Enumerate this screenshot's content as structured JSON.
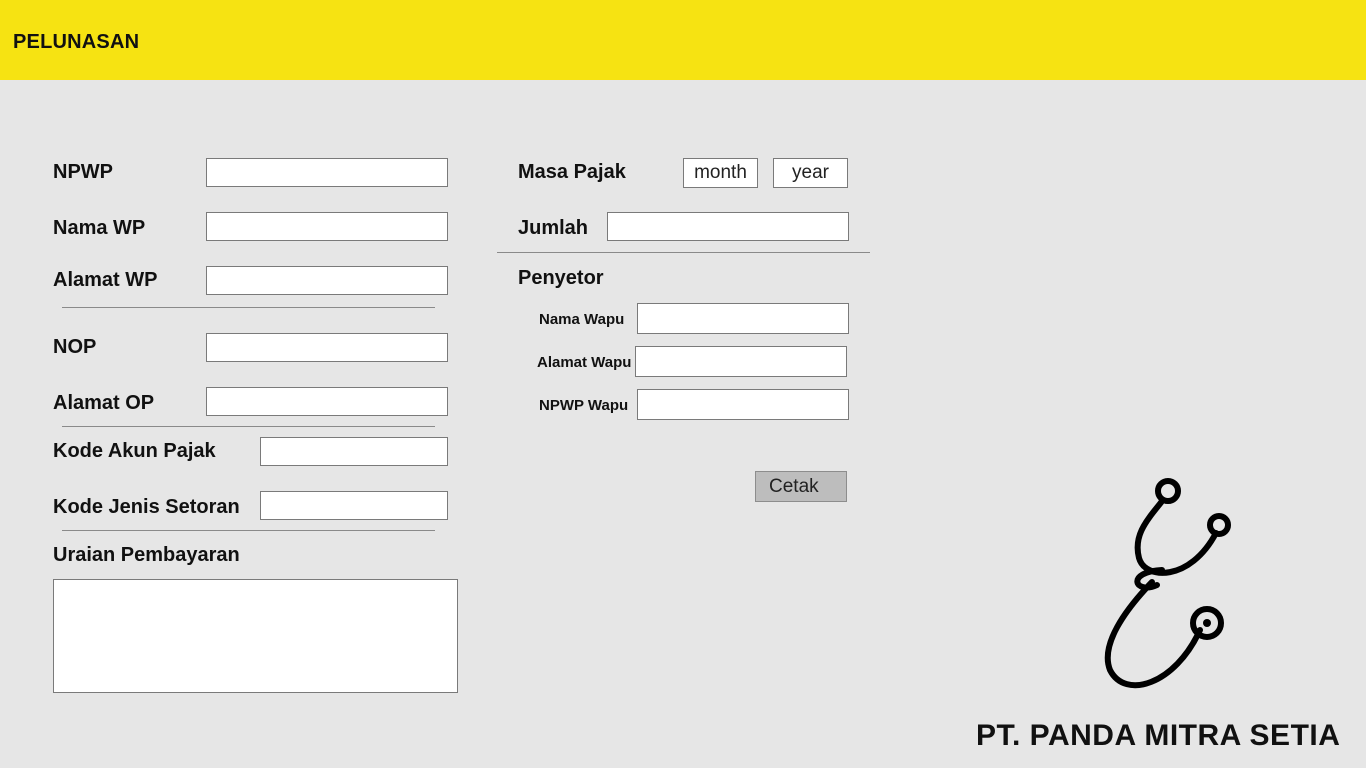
{
  "header": {
    "title": "PELUNASAN",
    "color": "#f6e312"
  },
  "form": {
    "npwp": {
      "label": "NPWP",
      "value": ""
    },
    "nama_wp": {
      "label": "Nama WP",
      "value": ""
    },
    "alamat_wp": {
      "label": "Alamat WP",
      "value": ""
    },
    "nop": {
      "label": "NOP",
      "value": ""
    },
    "alamat_op": {
      "label": "Alamat OP",
      "value": ""
    },
    "kode_akun_pajak": {
      "label": "Kode Akun Pajak",
      "value": ""
    },
    "kode_jenis_setoran": {
      "label": "Kode Jenis Setoran",
      "value": ""
    },
    "uraian_pembayaran": {
      "label": "Uraian Pembayaran",
      "value": ""
    },
    "masa_pajak": {
      "label": "Masa Pajak",
      "month": "month",
      "year": "year"
    },
    "jumlah": {
      "label": "Jumlah",
      "value": ""
    },
    "penyetor": {
      "heading": "Penyetor",
      "nama_wapu": {
        "label": "Nama Wapu",
        "value": ""
      },
      "alamat_wapu": {
        "label": "Alamat Wapu",
        "value": ""
      },
      "npwp_wapu": {
        "label": "NPWP Wapu",
        "value": ""
      }
    },
    "submit_label": "Cetak"
  },
  "brand": {
    "company_name": "PT. PANDA MITRA SETIA",
    "logo_icon": "stethoscope-icon"
  }
}
